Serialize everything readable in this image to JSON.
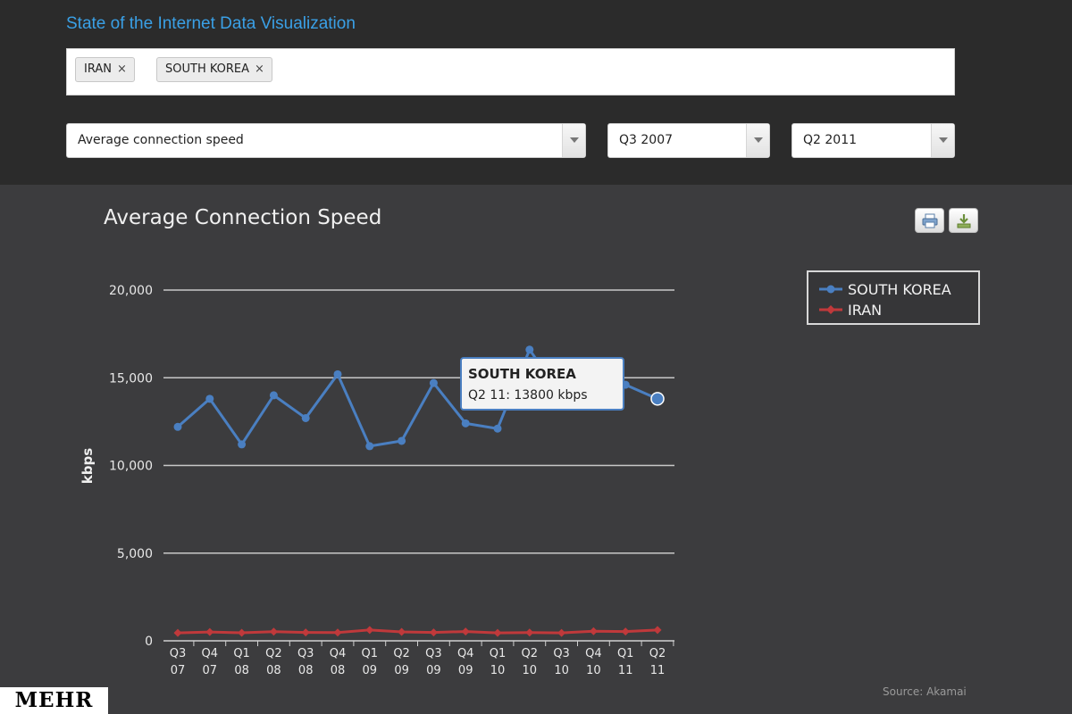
{
  "header": {
    "title": "State of the Internet Data Visualization",
    "tags": [
      {
        "label": "IRAN",
        "remove": "×"
      },
      {
        "label": "SOUTH KOREA",
        "remove": "×"
      }
    ],
    "metric_select": "Average connection speed",
    "start_select": "Q3 2007",
    "end_select": "Q2 2011"
  },
  "toolbar": {
    "print_icon": "printer-icon",
    "download_icon": "download-icon"
  },
  "tooltip": {
    "title": "SOUTH KOREA",
    "body": "Q2 11: 13800 kbps"
  },
  "source": "Source: Akamai",
  "logo": "MEHR",
  "colors": {
    "south_korea": "#4a7fc1",
    "iran": "#c0393b",
    "accent": "#3aa0e6"
  },
  "chart_data": {
    "type": "line",
    "title": "Average Connection Speed",
    "ylabel": "kbps",
    "xlabel": "",
    "ylim": [
      0,
      20000
    ],
    "yticks": [
      0,
      5000,
      10000,
      15000,
      20000
    ],
    "ytick_labels": [
      "0",
      "5,000",
      "10,000",
      "15,000",
      "20,000"
    ],
    "categories": [
      [
        "Q3",
        "07"
      ],
      [
        "Q4",
        "07"
      ],
      [
        "Q1",
        "08"
      ],
      [
        "Q2",
        "08"
      ],
      [
        "Q3",
        "08"
      ],
      [
        "Q4",
        "08"
      ],
      [
        "Q1",
        "09"
      ],
      [
        "Q2",
        "09"
      ],
      [
        "Q3",
        "09"
      ],
      [
        "Q4",
        "09"
      ],
      [
        "Q1",
        "10"
      ],
      [
        "Q2",
        "10"
      ],
      [
        "Q3",
        "10"
      ],
      [
        "Q4",
        "10"
      ],
      [
        "Q1",
        "11"
      ],
      [
        "Q2",
        "11"
      ]
    ],
    "grid": true,
    "legend": "top-right",
    "series": [
      {
        "name": "SOUTH KOREA",
        "color": "#4a7fc1",
        "values": [
          12200,
          13800,
          11200,
          14000,
          12700,
          15200,
          11100,
          11400,
          14700,
          12400,
          12100,
          16600,
          14000,
          13800,
          14600,
          13800
        ]
      },
      {
        "name": "IRAN",
        "color": "#c0393b",
        "values": [
          450,
          500,
          460,
          520,
          480,
          470,
          620,
          510,
          480,
          530,
          450,
          470,
          450,
          550,
          530,
          620
        ]
      }
    ]
  }
}
